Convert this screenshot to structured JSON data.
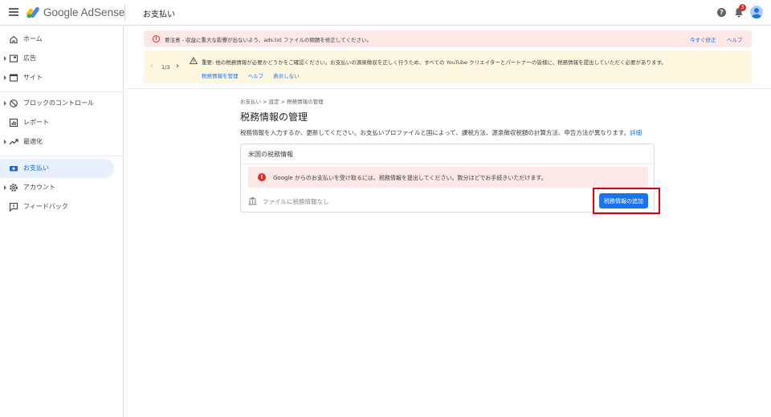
{
  "app": {
    "brand": "Google AdSense",
    "page_title": "お支払い",
    "notifications_count": "3",
    "help_glyph": "?"
  },
  "sidebar": {
    "items": [
      {
        "label": "ホーム",
        "icon": "home-icon",
        "expandable": false,
        "active": false
      },
      {
        "label": "広告",
        "icon": "ads-icon",
        "expandable": true,
        "active": false
      },
      {
        "label": "サイト",
        "icon": "sites-icon",
        "expandable": true,
        "active": false
      },
      {
        "label": "ブロックのコントロール",
        "icon": "block-icon",
        "expandable": true,
        "active": false
      },
      {
        "label": "レポート",
        "icon": "report-icon",
        "expandable": false,
        "active": false
      },
      {
        "label": "最適化",
        "icon": "trending-icon",
        "expandable": true,
        "active": false
      },
      {
        "label": "お支払い",
        "icon": "payment-icon",
        "expandable": false,
        "active": true
      },
      {
        "label": "アカウント",
        "icon": "gear-icon",
        "expandable": true,
        "active": false
      },
      {
        "label": "フィードバック",
        "icon": "feedback-icon",
        "expandable": false,
        "active": false
      }
    ]
  },
  "alerts": {
    "red": {
      "text": "要注意 - 収益に重大な影響が出ないよう、ads.txt ファイルの問題を修正してください。",
      "fix_label": "今すぐ修正",
      "help_label": "ヘルプ"
    },
    "yellow": {
      "pager": "1/3",
      "text": "重要: 他の税務情報が必要かどうかをご確認ください。お支払いの源泉徴収を正しく行うため、すべての YouTube クリエイターとパートナーの皆様に、税務情報を提出していただく必要があります。",
      "links": [
        "税務情報を管理",
        "ヘルプ",
        "表示しない"
      ]
    }
  },
  "main": {
    "breadcrumb": "お支払い  >  設定  >  税務情報の管理",
    "title": "税務情報の管理",
    "description": "税務情報を入力するか、更新してください。お支払いプロファイルと国によって、課税方法、源泉徴収税額の計算方法、申告方法が異なります。",
    "description_link": "詳細",
    "card": {
      "title": "米国の税務情報",
      "alert_text": "Google からのお支払いを受け取るには、税務情報を提出してください。数分ほどでお手続きいただけます。",
      "no_file_text": "ファイルに税務情報なし",
      "add_button": "税務情報の追加"
    }
  },
  "colors": {
    "accent": "#1a73e8",
    "error": "#d93025",
    "alert_red_bg": "#fce8e6",
    "alert_yellow_bg": "#fef7e0",
    "highlight": "#d9000d",
    "active_nav_bg": "#e8f0fe"
  }
}
